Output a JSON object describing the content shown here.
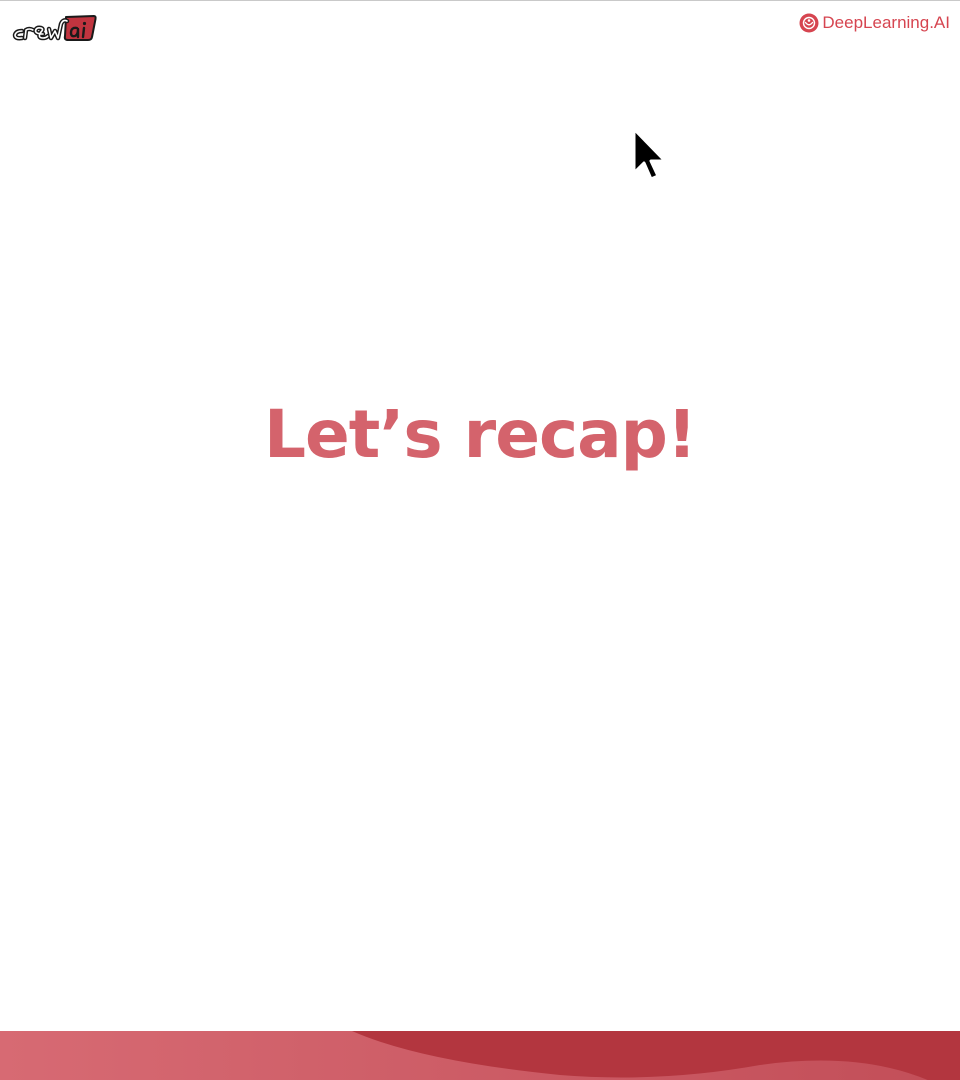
{
  "header": {
    "left_logo_name": "crewai-logo",
    "left_logo_text": "crewai",
    "right_logo_icon": "deeplearning-ai-icon",
    "right_logo_text": "DeepLearning.AI"
  },
  "main": {
    "title": "Let’s recap!"
  },
  "cursor": {
    "icon": "arrow-cursor-icon"
  },
  "colors": {
    "title": "#d4636c",
    "brand_red": "#d64550",
    "footer_light": "#d76a73",
    "footer_dark": "#b3363f"
  }
}
